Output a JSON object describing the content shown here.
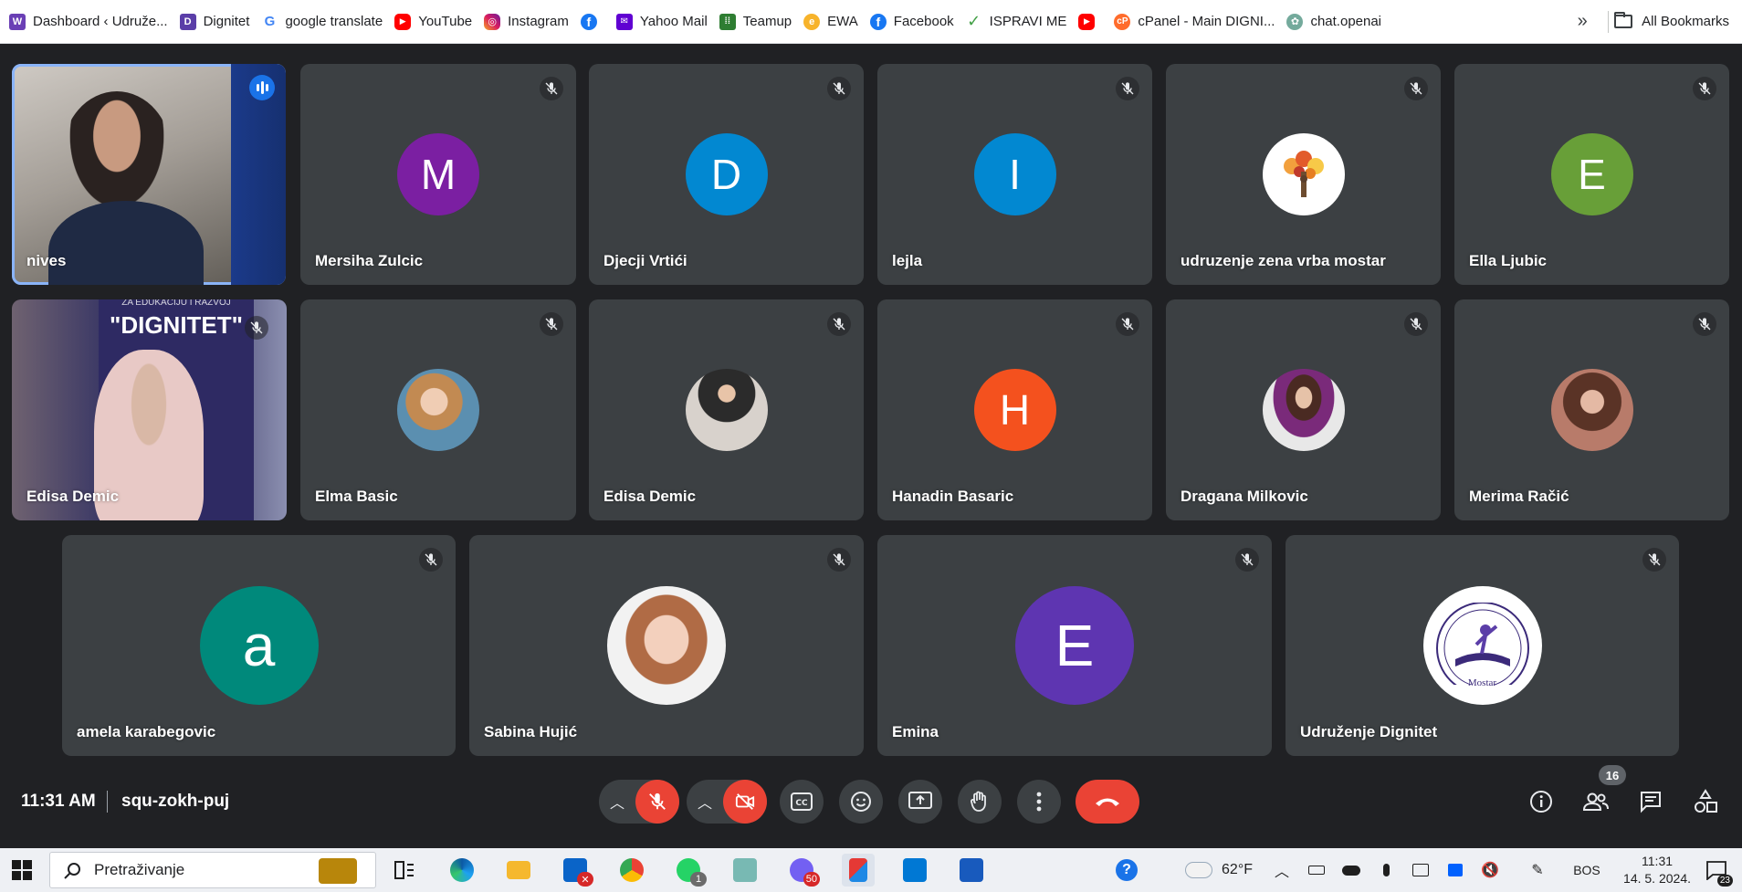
{
  "bookmarks": {
    "items": [
      {
        "label": "Dashboard ‹ Udruže...",
        "icon": "wordpress-icon"
      },
      {
        "label": "Dignitet",
        "icon": "dignitet-icon"
      },
      {
        "label": "google translate",
        "icon": "google-icon"
      },
      {
        "label": "YouTube",
        "icon": "youtube-icon"
      },
      {
        "label": "Instagram",
        "icon": "instagram-icon"
      },
      {
        "label": "",
        "icon": "facebook-icon"
      },
      {
        "label": "Yahoo Mail",
        "icon": "yahoo-mail-icon"
      },
      {
        "label": "Teamup",
        "icon": "teamup-icon"
      },
      {
        "label": "EWA",
        "icon": "ewa-icon"
      },
      {
        "label": "Facebook",
        "icon": "facebook-icon"
      },
      {
        "label": "ISPRAVI ME",
        "icon": "checkmark-icon"
      },
      {
        "label": "",
        "icon": "youtube-icon"
      },
      {
        "label": "cPanel - Main DIGNI...",
        "icon": "cpanel-icon"
      },
      {
        "label": "chat.openai",
        "icon": "openai-icon"
      }
    ],
    "more": "»",
    "all_bookmarks": "All Bookmarks"
  },
  "participants": [
    {
      "name": "nives",
      "type": "video",
      "speaking": true
    },
    {
      "name": "Mersiha Zulcic",
      "initial": "M",
      "color": "#7b1fa2"
    },
    {
      "name": "Djecji Vrtići",
      "initial": "D",
      "color": "#0288d1"
    },
    {
      "name": "lejla",
      "initial": "I",
      "color": "#0288d1"
    },
    {
      "name": "udruzenje zena vrba mostar",
      "type": "logo",
      "icon": "tree-logo-icon"
    },
    {
      "name": "Ella Ljubic",
      "initial": "E",
      "color": "#689f38"
    },
    {
      "name": "Edisa Demic",
      "type": "video",
      "banner": "\"DIGNITET\"",
      "banner_top": "ZA EDUKACIJU I RAZVOJ"
    },
    {
      "name": "Elma Basic",
      "type": "photo"
    },
    {
      "name": "Edisa Demic",
      "type": "photo"
    },
    {
      "name": "Hanadin Basaric",
      "initial": "H",
      "color": "#f4511e"
    },
    {
      "name": "Dragana Milkovic",
      "type": "photo"
    },
    {
      "name": "Merima Račić",
      "type": "photo"
    },
    {
      "name": "amela karabegovic",
      "initial": "a",
      "color": "#00897b"
    },
    {
      "name": "Sabina Hujić",
      "type": "photo"
    },
    {
      "name": "Emina",
      "initial": "E",
      "color": "#5e35b1"
    },
    {
      "name": "Udruženje Dignitet",
      "type": "logo",
      "icon": "dignitet-seal-icon",
      "logo_text": "Mostar"
    }
  ],
  "meeting": {
    "time": "11:31 AM",
    "code": "squ-zokh-puj",
    "participants_count": "16",
    "colors": {
      "end_call": "#ea4335",
      "muted": "#ea4335",
      "control": "#3c4043"
    }
  },
  "taskbar": {
    "search_placeholder": "Pretraživanje",
    "outlook_badge": "✕",
    "whatsapp_badge": "1",
    "viber_badge": "50",
    "weather": "62°F",
    "language": "BOS",
    "time": "11:31",
    "date": "14. 5. 2024.",
    "notifications": "23"
  }
}
